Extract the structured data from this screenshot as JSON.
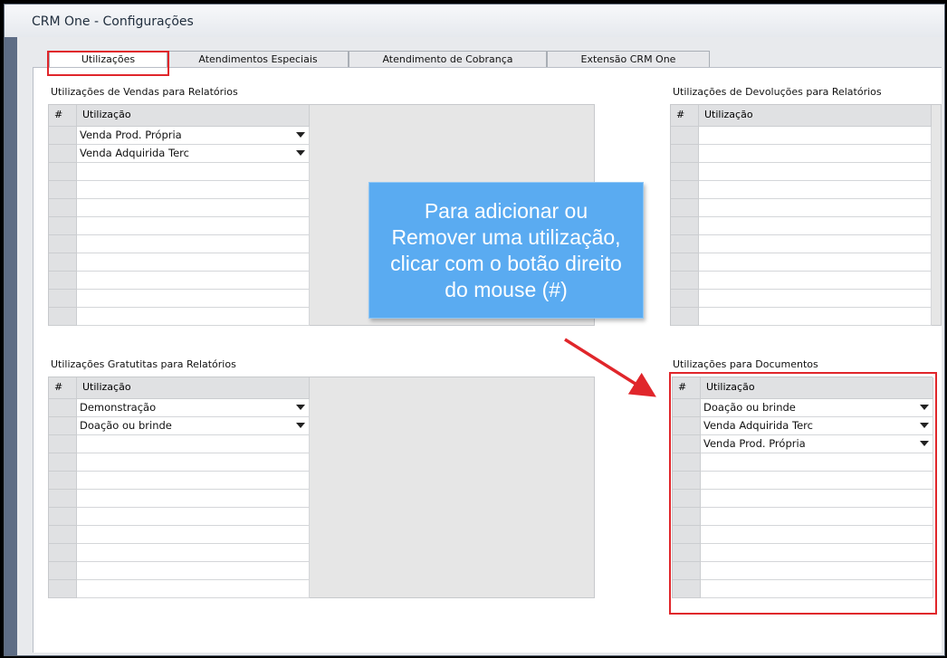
{
  "window": {
    "title": "CRM One - Configurações"
  },
  "tabs": [
    {
      "label": "Utilizações",
      "active": true
    },
    {
      "label": "Atendimentos Especiais",
      "active": false
    },
    {
      "label": "Atendimento de Cobrança",
      "active": false
    },
    {
      "label": "Extensão CRM One",
      "active": false
    }
  ],
  "grids": {
    "vendas": {
      "title": "Utilizações de Vendas para Relatórios",
      "col_hash": "#",
      "col_util": "Utilização",
      "rows": [
        "Venda Prod. Própria",
        "Venda Adquirida Terc"
      ]
    },
    "devolucoes": {
      "title": "Utilizações de Devoluções para Relatórios",
      "col_hash": "#",
      "col_util": "Utilização",
      "rows": []
    },
    "gratuitas": {
      "title": "Utilizações Gratutitas para Relatórios",
      "col_hash": "#",
      "col_util": "Utilização",
      "rows": [
        "Demonstração",
        "Doação ou brinde"
      ]
    },
    "documentos": {
      "title": "Utilizações para Documentos",
      "col_hash": "#",
      "col_util": "Utilização",
      "rows": [
        "Doação ou brinde",
        "Venda Adquirida Terc",
        "Venda Prod. Própria"
      ]
    }
  },
  "callout": {
    "text": "Para adicionar ou\nRemover uma utilização,\nclicar com o botão direito\ndo mouse (#)"
  },
  "colors": {
    "accent_red": "#e0262b",
    "callout_blue": "#5aabf1"
  }
}
